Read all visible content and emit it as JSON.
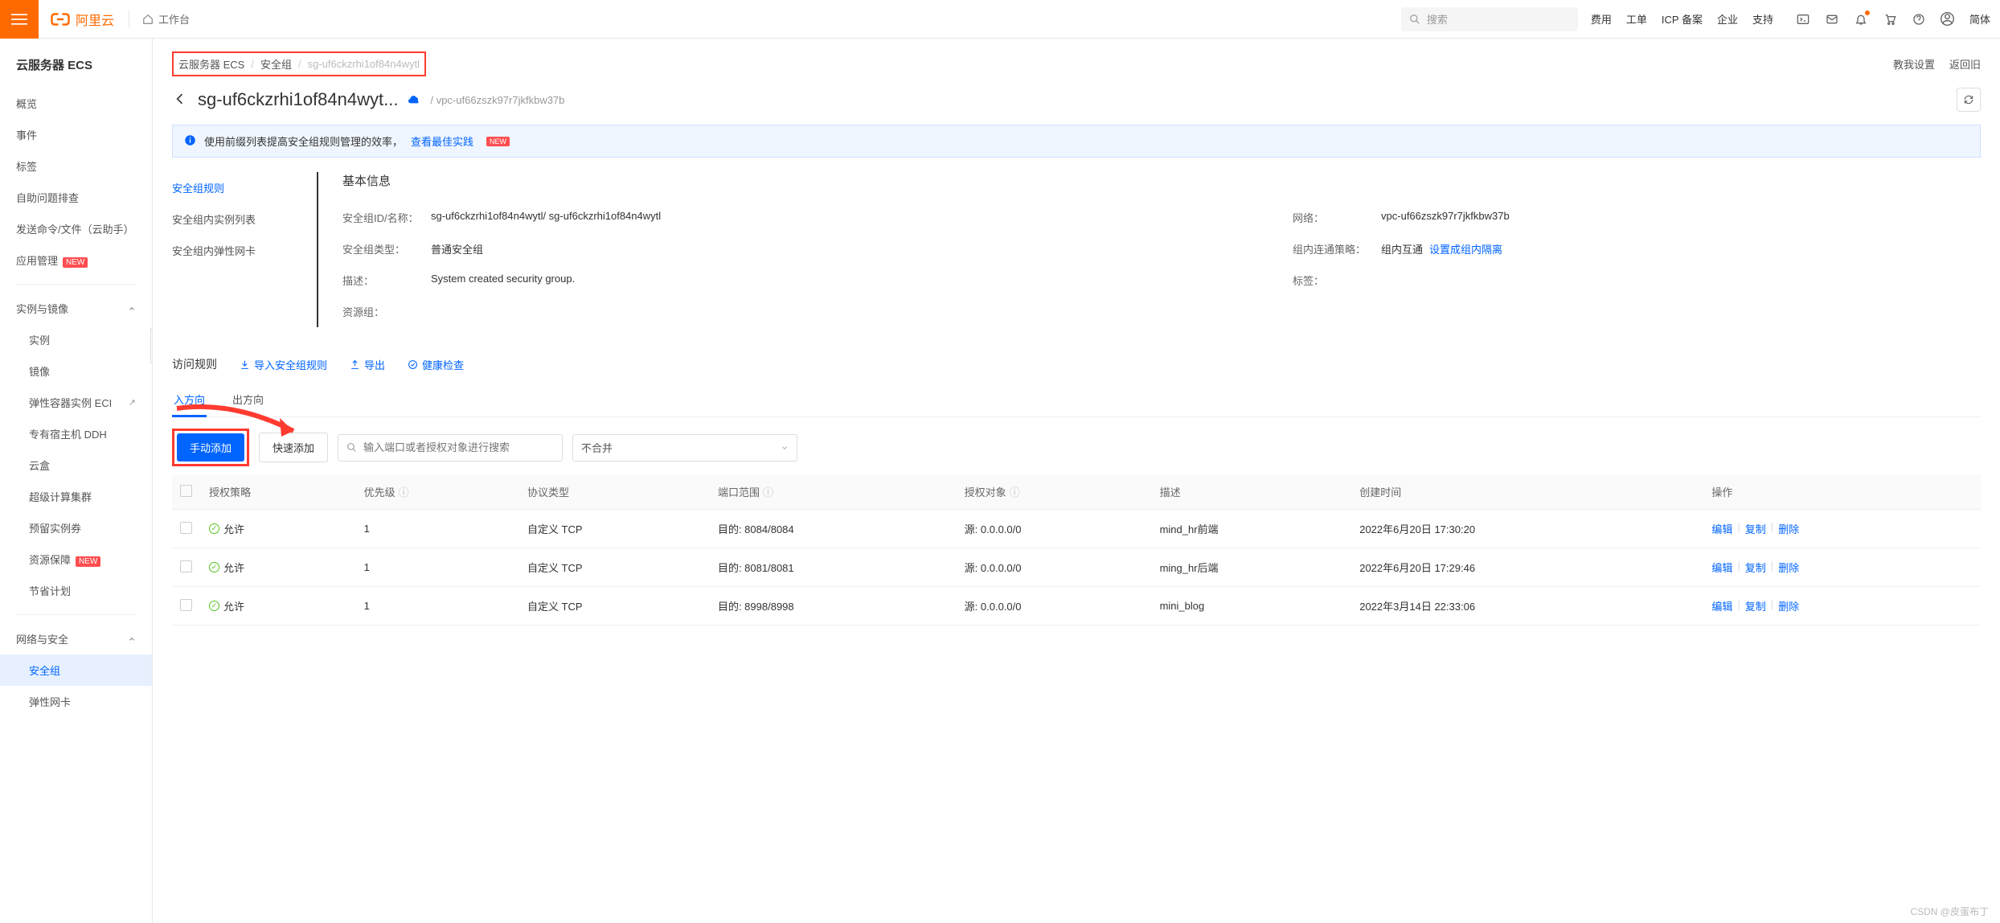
{
  "top": {
    "brand": "阿里云",
    "workbench": "工作台",
    "search_placeholder": "搜索",
    "links": [
      "费用",
      "工单",
      "ICP 备案",
      "企业",
      "支持"
    ],
    "lang": "简体"
  },
  "sidebar": {
    "title": "云服务器 ECS",
    "items_top": [
      "概览",
      "事件",
      "标签",
      "自助问题排查",
      "发送命令/文件（云助手）"
    ],
    "app_manage": "应用管理",
    "group1_title": "实例与镜像",
    "group1_items": [
      "实例",
      "镜像",
      "弹性容器实例 ECI",
      "专有宿主机 DDH",
      "云盒",
      "超级计算集群",
      "预留实例券"
    ],
    "res_assure": "资源保障",
    "save_plan": "节省计划",
    "group2_title": "网络与安全",
    "group2_items": [
      "安全组",
      "弹性网卡"
    ]
  },
  "breadcrumb": {
    "a": "云服务器 ECS",
    "b": "安全组",
    "c": "sg-uf6ckzrhi1of84n4wytl",
    "teach": "教我设置",
    "back_old": "返回旧"
  },
  "header": {
    "title": "sg-uf6ckzrhi1of84n4wyt...",
    "vpc_prefix": "/ ",
    "vpc": "vpc-uf66zszk97r7jkfkbw37b"
  },
  "banner": {
    "text": "使用前缀列表提高安全组规则管理的效率，",
    "link": "查看最佳实践",
    "new": "NEW"
  },
  "detail_nav": {
    "a": "安全组规则",
    "b": "安全组内实例列表",
    "c": "安全组内弹性网卡"
  },
  "info": {
    "section": "基本信息",
    "id_label": "安全组ID/名称：",
    "id_val": "sg-uf6ckzrhi1of84n4wytl/ sg-uf6ckzrhi1of84n4wytl",
    "net_label": "网络：",
    "net_val": "vpc-uf66zszk97r7jkfkbw37b",
    "type_label": "安全组类型：",
    "type_val": "普通安全组",
    "policy_label": "组内连通策略：",
    "policy_val": "组内互通",
    "policy_link": "设置成组内隔离",
    "desc_label": "描述：",
    "desc_val": "System created security group.",
    "tag_label": "标签：",
    "rg_label": "资源组："
  },
  "rules": {
    "title": "访问规则",
    "import": "导入安全组规则",
    "export": "导出",
    "health": "健康检查",
    "tab_in": "入方向",
    "tab_out": "出方向",
    "btn_manual": "手动添加",
    "btn_quick": "快速添加",
    "search_placeholder": "输入端口或者授权对象进行搜索",
    "merge_sel": "不合并"
  },
  "table": {
    "cols": {
      "policy": "授权策略",
      "priority": "优先级",
      "proto": "协议类型",
      "port": "端口范围",
      "obj": "授权对象",
      "desc": "描述",
      "time": "创建时间",
      "ops": "操作"
    },
    "allow": "允许",
    "rows": [
      {
        "priority": "1",
        "proto": "自定义 TCP",
        "port": "目的: 8084/8084",
        "obj": "源: 0.0.0.0/0",
        "desc": "mind_hr前端",
        "time": "2022年6月20日 17:30:20"
      },
      {
        "priority": "1",
        "proto": "自定义 TCP",
        "port": "目的: 8081/8081",
        "obj": "源: 0.0.0.0/0",
        "desc": "ming_hr后端",
        "time": "2022年6月20日 17:29:46"
      },
      {
        "priority": "1",
        "proto": "自定义 TCP",
        "port": "目的: 8998/8998",
        "obj": "源: 0.0.0.0/0",
        "desc": "mini_blog",
        "time": "2022年3月14日 22:33:06"
      }
    ],
    "ops": {
      "edit": "编辑",
      "copy": "复制",
      "del": "删除"
    }
  },
  "watermark": "CSDN @皮蛋布丁"
}
